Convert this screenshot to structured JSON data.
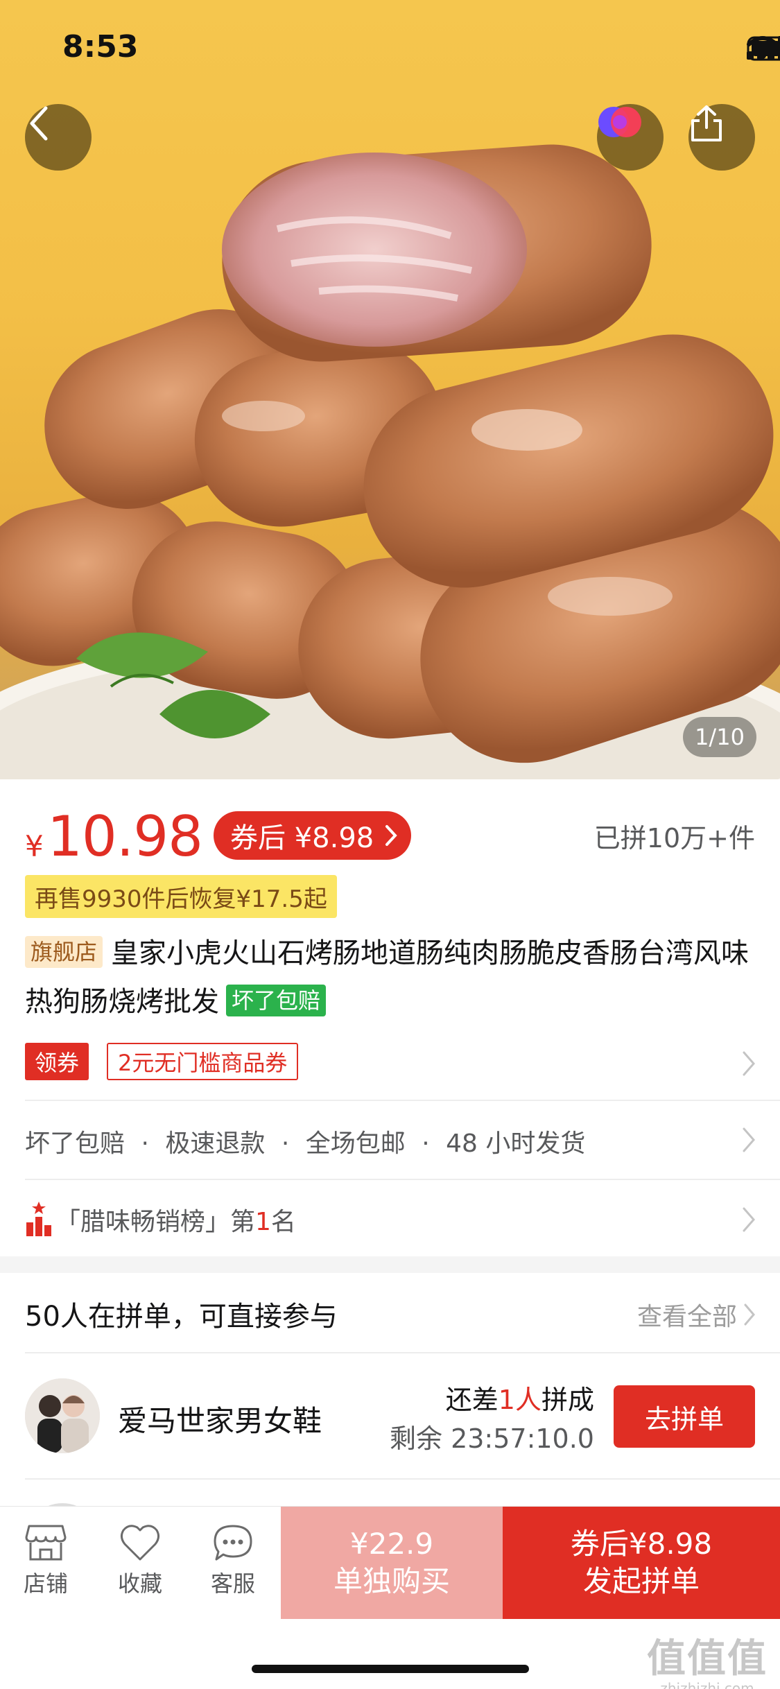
{
  "status_bar": {
    "time": "8:53"
  },
  "gallery": {
    "counter": "1/10"
  },
  "price": {
    "currency_symbol": "¥",
    "current": "10.98",
    "coupon_label": "券后 ¥8.98",
    "sold": "已拼10万+件",
    "resale_notice": "再售9930件后恢复¥17.5起"
  },
  "product": {
    "store_tag": "旗舰店",
    "title": "皇家小虎火山石烤肠地道肠纯肉肠脆皮香肠台湾风味热狗肠烧烤批发",
    "guarantee_tag": "坏了包赔"
  },
  "coupon_row": {
    "claim_label": "领券",
    "coupon_text": "2元无门槛商品券"
  },
  "services": {
    "items": [
      "坏了包赔",
      "极速退款",
      "全场包邮",
      "48 小时发货"
    ],
    "separator": "·"
  },
  "ranking": {
    "prefix": "「腊味畅销榜」第",
    "rank": "1",
    "suffix": "名"
  },
  "group": {
    "title": "50人在拼单，可直接参与",
    "view_all": "查看全部",
    "items": [
      {
        "name": "爱马世家男女鞋",
        "need_prefix": "还差",
        "need_count": "1人",
        "need_suffix": "拼成",
        "remaining": "剩余 23:57:10.0",
        "join_label": "去拼单"
      }
    ]
  },
  "bottom_bar": {
    "tabs": [
      {
        "label": "店铺",
        "icon": "store-icon"
      },
      {
        "label": "收藏",
        "icon": "heart-icon"
      },
      {
        "label": "客服",
        "icon": "chat-icon"
      }
    ],
    "single_price": "¥22.9",
    "single_label": "单独购买",
    "group_price": "券后¥8.98",
    "group_label": "发起拼单"
  },
  "watermark": {
    "big": "值值值",
    "small": "zhizhizhi.com"
  },
  "colors": {
    "accent": "#e02e24",
    "accent_light": "#f0a8a3",
    "resale_bg": "#fbe565",
    "guarantee_green": "#2bb24c",
    "hero_bg": "#f5c64e"
  }
}
